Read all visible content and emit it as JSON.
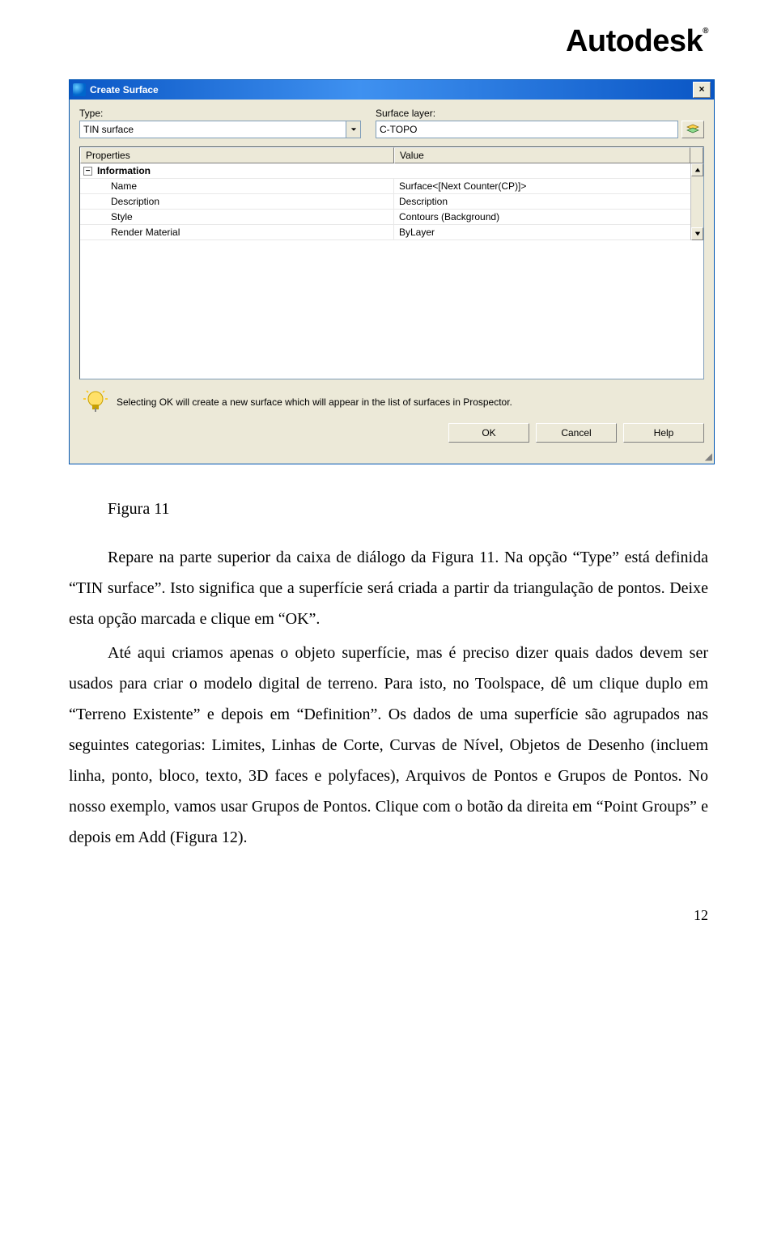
{
  "brand": "Autodesk",
  "dialog": {
    "title": "Create Surface",
    "type_label": "Type:",
    "type_value": "TIN surface",
    "layer_label": "Surface layer:",
    "layer_value": "C-TOPO",
    "grid_header_properties": "Properties",
    "grid_header_value": "Value",
    "group_information": "Information",
    "rows": [
      {
        "prop": "Name",
        "val": "Surface<[Next Counter(CP)]>"
      },
      {
        "prop": "Description",
        "val": "Description"
      },
      {
        "prop": "Style",
        "val": "Contours (Background)"
      },
      {
        "prop": "Render Material",
        "val": "ByLayer"
      }
    ],
    "hint": "Selecting OK will create a new surface which will appear in the list of surfaces in Prospector.",
    "ok": "OK",
    "cancel": "Cancel",
    "help": "Help"
  },
  "doc": {
    "caption": "Figura 11",
    "p1": "Repare na parte superior da caixa de diálogo da Figura 11. Na opção “Type” está definida “TIN surface”. Isto significa que a superfície será criada a partir da triangulação de pontos. Deixe esta opção marcada e clique em “OK”.",
    "p2": "Até aqui criamos apenas o objeto superfície, mas é preciso dizer quais dados devem ser usados para criar o modelo digital de terreno. Para isto, no Toolspace, dê um clique duplo em “Terreno Existente” e depois em “Definition”. Os dados de uma superfície são agrupados nas seguintes categorias: Limites, Linhas de Corte, Curvas de Nível, Objetos de Desenho (incluem linha, ponto, bloco, texto, 3D faces e polyfaces), Arquivos de Pontos e Grupos de Pontos. No nosso exemplo, vamos usar Grupos de Pontos. Clique com o botão da direita em “Point Groups” e depois em Add (Figura 12).",
    "pagenum": "12"
  }
}
